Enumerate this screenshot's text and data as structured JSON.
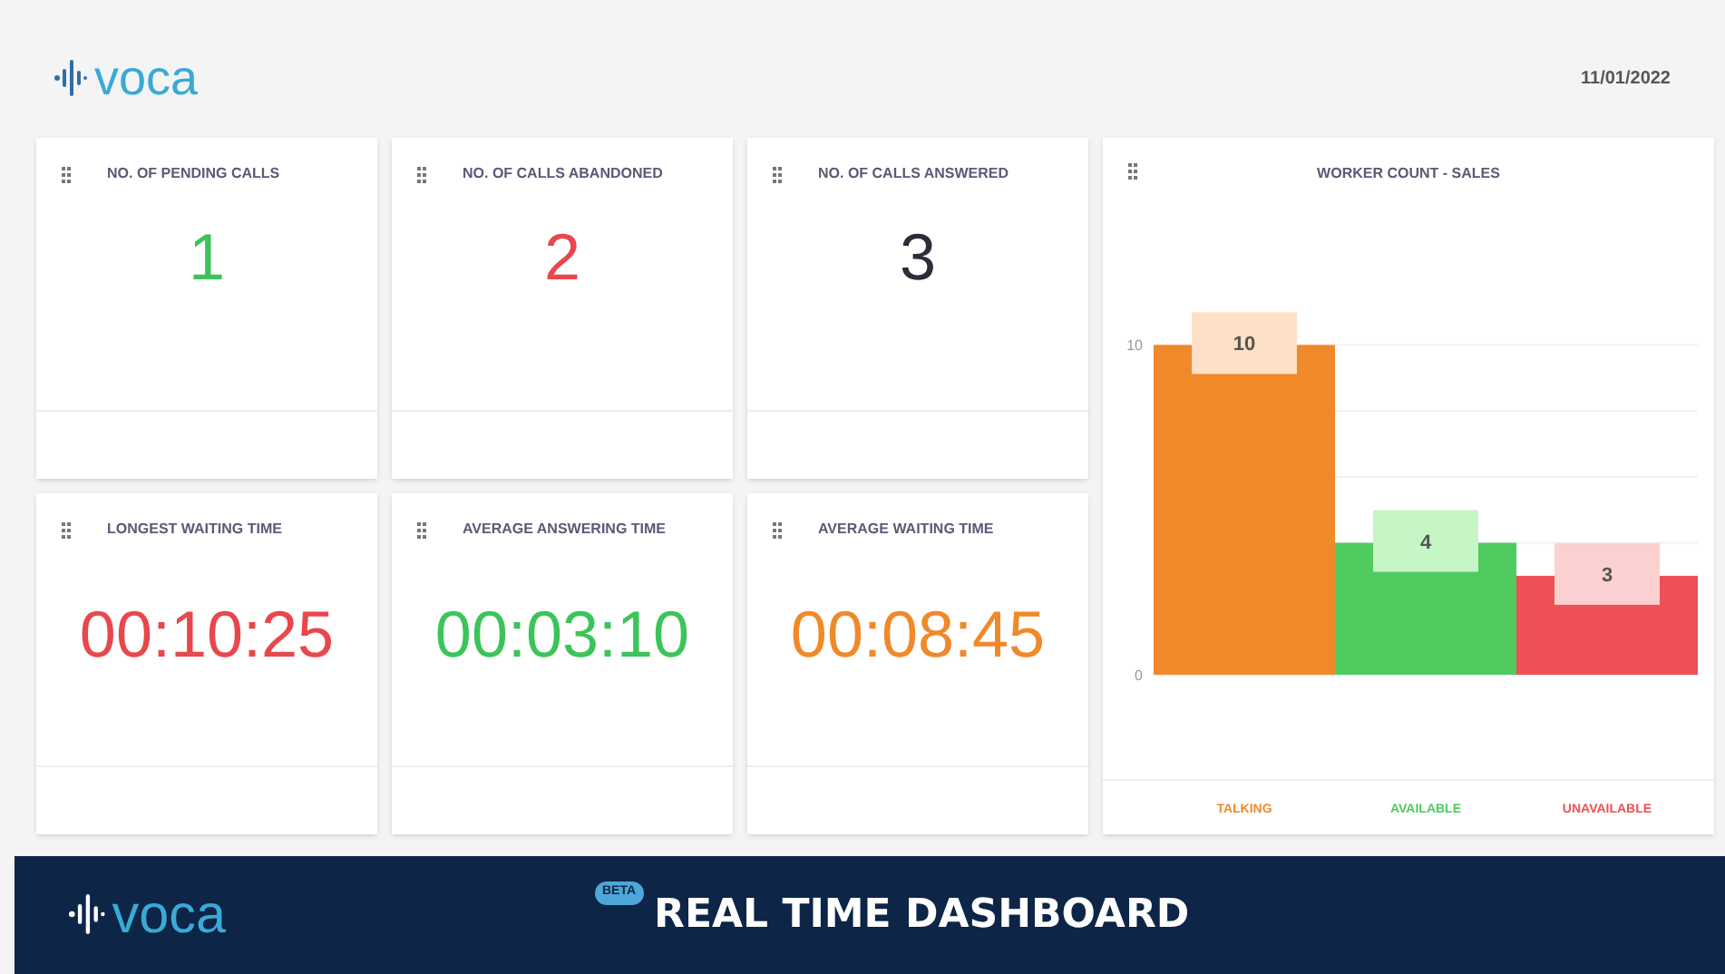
{
  "header": {
    "logo": "voca",
    "date": "11/01/2022"
  },
  "metrics": [
    {
      "title": "NO. OF PENDING CALLS",
      "value": "1",
      "color": "#3cc45a"
    },
    {
      "title": "NO. OF CALLS ABANDONED",
      "value": "2",
      "color": "#e8474c"
    },
    {
      "title": "NO. OF CALLS ANSWERED",
      "value": "3",
      "color": "#2b2d3a"
    },
    {
      "title": "LONGEST WAITING TIME",
      "value": "00:10:25",
      "color": "#e8474c"
    },
    {
      "title": "AVERAGE ANSWERING TIME",
      "value": "00:03:10",
      "color": "#3cc45a"
    },
    {
      "title": "AVERAGE WAITING TIME",
      "value": "00:08:45",
      "color": "#f0892a"
    }
  ],
  "chart": {
    "title": "WORKER COUNT - SALES",
    "chart_data": {
      "type": "bar",
      "series": [
        {
          "name": "TALKING",
          "color": "#f0892a",
          "values": [
            10
          ]
        },
        {
          "name": "AVAILABLE",
          "color": "#4fcb5f",
          "values": [
            4
          ]
        },
        {
          "name": "UNAVAILABLE",
          "color": "#ee5056",
          "values": [
            3
          ]
        }
      ],
      "ylim": [
        0,
        11
      ],
      "yticks": [
        0,
        10
      ],
      "data_labels": true
    }
  },
  "footer": {
    "logo": "voca",
    "badge": "BETA",
    "title": "REAL TIME DASHBOARD"
  }
}
